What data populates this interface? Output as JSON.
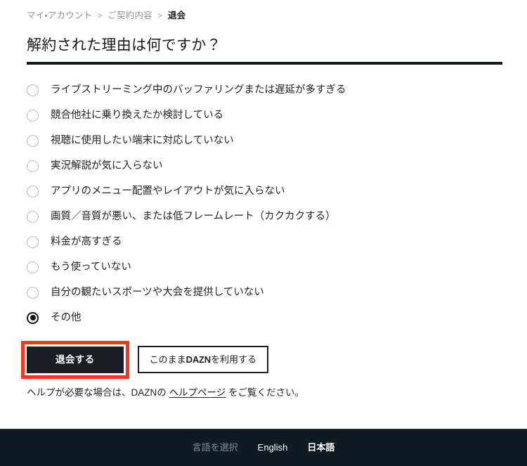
{
  "breadcrumb": {
    "items": [
      {
        "label": "マイ・アカウント",
        "current": false
      },
      {
        "label": "ご契約内容",
        "current": false
      },
      {
        "label": "退会",
        "current": true
      }
    ],
    "separator": ">"
  },
  "page": {
    "title": "解約された理由は何ですか？"
  },
  "survey": {
    "options": [
      {
        "label": "ライブストリーミング中のバッファリングまたは遅延が多すぎる",
        "selected": false
      },
      {
        "label": "競合他社に乗り換えたか検討している",
        "selected": false
      },
      {
        "label": "視聴に使用したい端末に対応していない",
        "selected": false
      },
      {
        "label": "実況解説が気に入らない",
        "selected": false
      },
      {
        "label": "アプリのメニュー配置やレイアウトが気に入らない",
        "selected": false
      },
      {
        "label": "画質／音質が悪い、または低フレームレート（カクカクする）",
        "selected": false
      },
      {
        "label": "料金が高すぎる",
        "selected": false
      },
      {
        "label": "もう使っていない",
        "selected": false
      },
      {
        "label": "自分の観たいスポーツや大会を提供していない",
        "selected": false
      },
      {
        "label": "その他",
        "selected": true
      }
    ],
    "selected_index": 9
  },
  "actions": {
    "primary_label": "退会する",
    "secondary_prefix": "このまま",
    "secondary_brand": "DAZN",
    "secondary_suffix": "を利用する",
    "highlight_color": "#f4361a"
  },
  "help": {
    "prefix": "ヘルプが必要な場合は、DAZNの ",
    "link_label": "ヘルプページ",
    "suffix": " をご覧ください。"
  },
  "footer": {
    "language_label": "言語を選択",
    "languages": [
      {
        "label": "English"
      },
      {
        "label": "日本語"
      }
    ],
    "background": "#101a20"
  }
}
